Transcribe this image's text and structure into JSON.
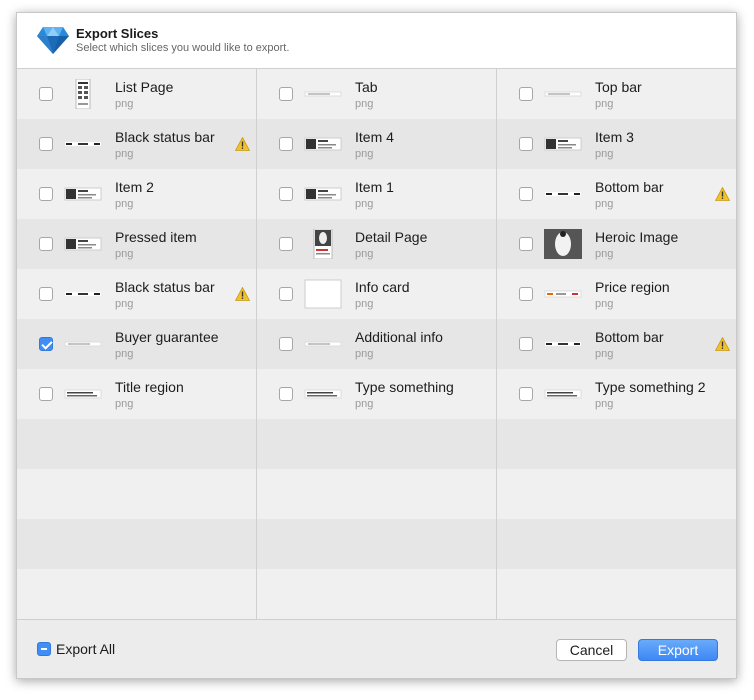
{
  "dialog": {
    "title": "Export Slices",
    "subtitle": "Select which slices you would like to export.",
    "logo_icon": "sketch-diamond-icon"
  },
  "columns": [
    {
      "items": [
        {
          "name": "List Page",
          "format": "png",
          "checked": false,
          "warning": false,
          "thumb": "page"
        },
        {
          "name": "Black status bar",
          "format": "png",
          "checked": false,
          "warning": true,
          "thumb": "bar"
        },
        {
          "name": "Item 2",
          "format": "png",
          "checked": false,
          "warning": false,
          "thumb": "item"
        },
        {
          "name": "Pressed item",
          "format": "png",
          "checked": false,
          "warning": false,
          "thumb": "item"
        },
        {
          "name": "Black status bar",
          "format": "png",
          "checked": false,
          "warning": true,
          "thumb": "bar"
        },
        {
          "name": "Buyer guarantee",
          "format": "png",
          "checked": true,
          "warning": false,
          "thumb": "line"
        },
        {
          "name": "Title region",
          "format": "png",
          "checked": false,
          "warning": false,
          "thumb": "text"
        }
      ]
    },
    {
      "items": [
        {
          "name": "Tab",
          "format": "png",
          "checked": false,
          "warning": false,
          "thumb": "line"
        },
        {
          "name": "Item 4",
          "format": "png",
          "checked": false,
          "warning": false,
          "thumb": "item"
        },
        {
          "name": "Item 1",
          "format": "png",
          "checked": false,
          "warning": false,
          "thumb": "item"
        },
        {
          "name": "Detail Page",
          "format": "png",
          "checked": false,
          "warning": false,
          "thumb": "detail"
        },
        {
          "name": "Info card",
          "format": "png",
          "checked": false,
          "warning": false,
          "thumb": "card"
        },
        {
          "name": "Additional info",
          "format": "png",
          "checked": false,
          "warning": false,
          "thumb": "line"
        },
        {
          "name": "Type something",
          "format": "png",
          "checked": false,
          "warning": false,
          "thumb": "text"
        }
      ]
    },
    {
      "items": [
        {
          "name": "Top bar",
          "format": "png",
          "checked": false,
          "warning": false,
          "thumb": "line"
        },
        {
          "name": "Item 3",
          "format": "png",
          "checked": false,
          "warning": false,
          "thumb": "item"
        },
        {
          "name": "Bottom bar",
          "format": "png",
          "checked": false,
          "warning": true,
          "thumb": "bar"
        },
        {
          "name": "Heroic Image",
          "format": "png",
          "checked": false,
          "warning": false,
          "thumb": "photo"
        },
        {
          "name": "Price region",
          "format": "png",
          "checked": false,
          "warning": false,
          "thumb": "price"
        },
        {
          "name": "Bottom bar",
          "format": "png",
          "checked": false,
          "warning": true,
          "thumb": "bar"
        },
        {
          "name": "Type something 2",
          "format": "png",
          "checked": false,
          "warning": false,
          "thumb": "text"
        }
      ]
    }
  ],
  "footer": {
    "export_all_label": "Export All",
    "cancel_label": "Cancel",
    "export_label": "Export"
  },
  "colors": {
    "accent": "#3f8ef7",
    "warning": "#f2c12e"
  }
}
